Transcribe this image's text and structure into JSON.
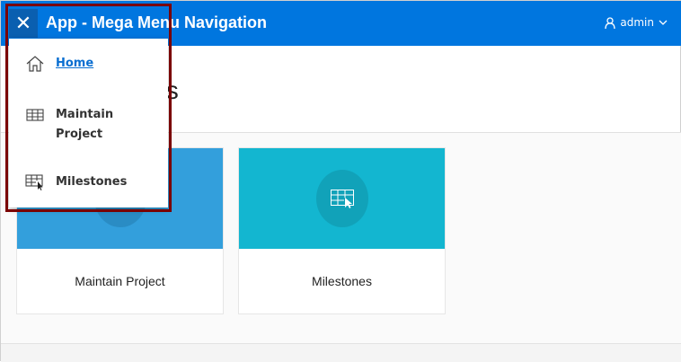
{
  "header": {
    "title": "App - Mega Menu Navigation",
    "user": "admin",
    "close_icon": "close-icon"
  },
  "page": {
    "heading_visible": "ts"
  },
  "cards": [
    {
      "label": "Maintain Project",
      "color": "#339fdc",
      "circle": "#2a8cc4"
    },
    {
      "label": "Milestones",
      "color": "#13b6d0",
      "circle": "#11a2b9"
    }
  ],
  "menu": {
    "items": [
      {
        "label": "Home",
        "icon": "home-icon",
        "current": true
      },
      {
        "label": "Maintain\nProject",
        "icon": "table-icon"
      },
      {
        "label": "Milestones",
        "icon": "table-pointer-icon"
      }
    ]
  }
}
